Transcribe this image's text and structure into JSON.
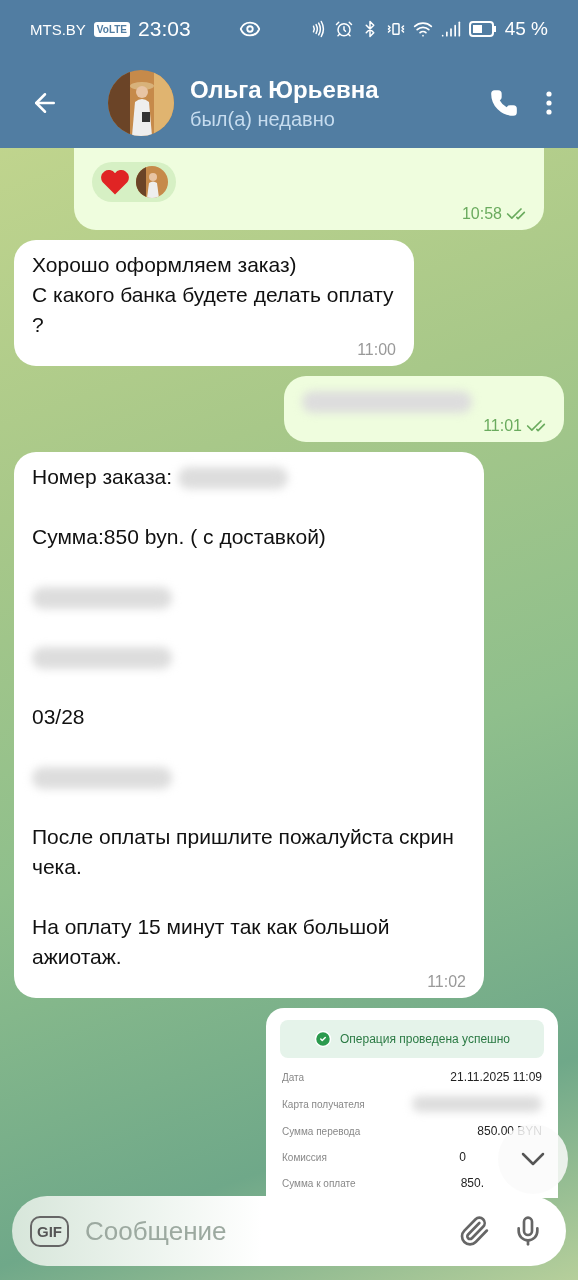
{
  "status_bar": {
    "carrier": "MTS.BY",
    "network_badge": "VoLTE",
    "time": "23:03",
    "battery_percent": "45 %"
  },
  "header": {
    "name": "Ольга Юрьевна",
    "status": "был(а) недавно"
  },
  "messages": [
    {
      "kind": "reactions",
      "outgoing": true,
      "time": "10:58",
      "read": true
    },
    {
      "kind": "text",
      "outgoing": false,
      "time": "11:00",
      "lines": [
        {
          "kind": "text",
          "text": "Хорошо оформляем заказ)"
        },
        {
          "kind": "text",
          "text": "С какого банка будете делать оплату ?"
        }
      ]
    },
    {
      "kind": "text",
      "outgoing": true,
      "time": "11:01",
      "read": true,
      "lines": [
        {
          "kind": "redacted"
        }
      ]
    },
    {
      "kind": "text",
      "outgoing": false,
      "time": "11:02",
      "lines": [
        {
          "kind": "text_redacted",
          "text": "Номер заказа:"
        },
        {
          "kind": "blank"
        },
        {
          "kind": "text",
          "text": "Сумма:850 byn. ( с доставкой)"
        },
        {
          "kind": "blank"
        },
        {
          "kind": "redacted"
        },
        {
          "kind": "blank"
        },
        {
          "kind": "redacted"
        },
        {
          "kind": "blank"
        },
        {
          "kind": "text",
          "text": "03/28"
        },
        {
          "kind": "blank"
        },
        {
          "kind": "redacted"
        },
        {
          "kind": "blank"
        },
        {
          "kind": "text",
          "text": "После оплаты пришлите пожалуйста скрин чека."
        },
        {
          "kind": "blank"
        },
        {
          "kind": "text",
          "text": "На оплату 15 минут так как большой ажиотаж."
        }
      ]
    },
    {
      "kind": "receipt",
      "outgoing": true,
      "banner": "Операция проведена успешно",
      "rows": [
        {
          "label": "Дата",
          "value": "21.11.2025 11:09"
        },
        {
          "label": "Карта получателя",
          "redacted": true
        },
        {
          "label": "Сумма перевода",
          "value": "850.00 BYN"
        },
        {
          "label": "Комиссия",
          "value": "0"
        },
        {
          "label": "Сумма к оплате",
          "value": "850."
        }
      ]
    }
  ],
  "composer": {
    "gif_label": "GIF",
    "placeholder": "Сообщение"
  }
}
